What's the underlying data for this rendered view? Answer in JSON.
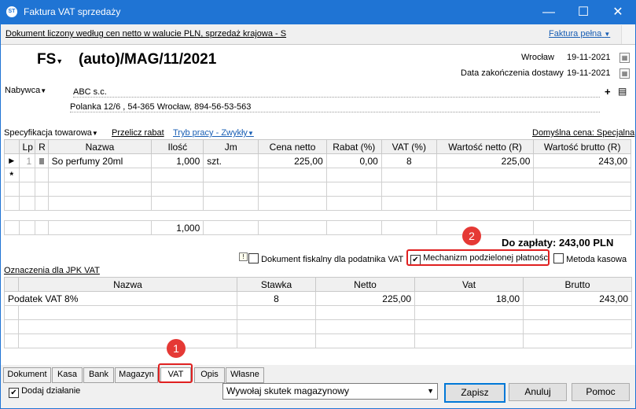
{
  "window": {
    "title": "Faktura VAT sprzedaży",
    "icon_text": "ST",
    "minimize": "—",
    "maximize": "☐",
    "close": "✕"
  },
  "infobar": {
    "description": "Dokument liczony według cen netto w walucie PLN, sprzedaż krajowa - S",
    "full_invoice": "Faktura pełna"
  },
  "header": {
    "doc_type": "FS",
    "doc_number": "(auto)/MAG/11/2021",
    "city": "Wrocław",
    "issue_date": "19-11-2021",
    "delivery_label": "Data zakończenia dostawy",
    "delivery_date": "19-11-2021"
  },
  "buyer": {
    "label": "Nabywca",
    "name": "ABC s.c.",
    "address": "Polanka  12/6 , 54-365 Wrocław, 894-56-53-563"
  },
  "toolbar": {
    "spec": "Specyfikacja towarowa",
    "recalc": "Przelicz rabat",
    "work_mode": "Tryb pracy - Zwykły",
    "default_price": "Domyślna cena: Specjalna"
  },
  "items_table": {
    "columns": [
      "Lp",
      "R",
      "Nazwa",
      "Ilość",
      "Jm",
      "Cena netto",
      "Rabat (%)",
      "VAT (%)",
      "Wartość netto (R)",
      "Wartość brutto (R)"
    ],
    "rows": [
      {
        "lp": "1",
        "name": "So perfumy 20ml",
        "qty": "1,000",
        "unit": "szt.",
        "net_price": "225,00",
        "discount": "0,00",
        "vat": "8",
        "net_value": "225,00",
        "gross_value": "243,00"
      }
    ],
    "new_row_marker": "*",
    "total_qty": "1,000"
  },
  "to_pay": "Do zapłaty: 243,00 PLN",
  "options": {
    "fiscal": "Dokument fiskalny dla podatnika VAT",
    "split_payment": "Mechanizm podzielonej płatności",
    "cash_method": "Metoda kasowa"
  },
  "jpk": {
    "label": "Oznaczenia dla JPK VAT"
  },
  "vat_table": {
    "columns": [
      "Nazwa",
      "Stawka",
      "Netto",
      "Vat",
      "Brutto"
    ],
    "rows": [
      {
        "name": "Podatek VAT 8%",
        "rate": "8",
        "net": "225,00",
        "vat": "18,00",
        "gross": "243,00"
      }
    ]
  },
  "tabs": [
    "Dokument",
    "Kasa",
    "Bank",
    "Magazyn",
    "VAT",
    "Opis",
    "Własne"
  ],
  "badges": {
    "one": "1",
    "two": "2"
  },
  "bottom": {
    "add_action": "Dodaj działanie",
    "action_select": "Wywołaj skutek magazynowy",
    "save": "Zapisz",
    "cancel": "Anuluj",
    "help": "Pomoc"
  },
  "colors": {
    "title_bar": "#1f74d4",
    "highlight": "#e02020",
    "badge": "#e53935",
    "link": "#1a5fb4"
  }
}
